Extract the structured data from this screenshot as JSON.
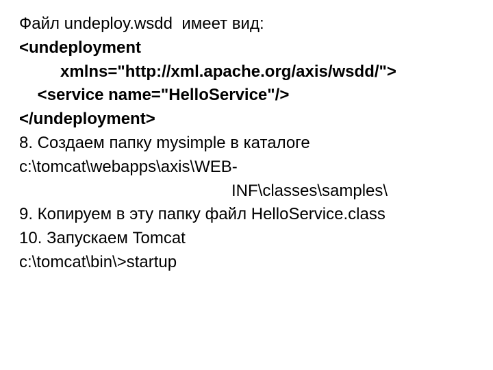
{
  "lines": {
    "l1": "Файл undeploy.wsdd  имеет вид:",
    "l2": "<undeployment",
    "l3": "         xmlns=\"http://xml.apache.org/axis/wsdd/\">",
    "l4": "    <service name=\"HelloService\"/>",
    "l5": "</undeployment>",
    "l6": "8. Создаем папку mysimple в каталоге",
    "l7": "c:\\tomcat\\webapps\\axis\\WEB-",
    "l8": "INF\\classes\\samples\\",
    "l9": "9. Копируем в эту папку файл HelloService.class",
    "l10": "10. Запускаем Tomcat",
    "l11": "c:\\tomcat\\bin\\>startup"
  }
}
